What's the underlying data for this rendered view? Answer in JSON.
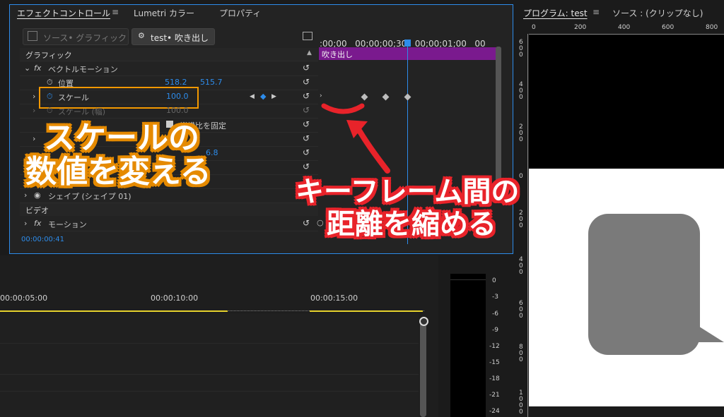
{
  "effect_panel": {
    "tabs": [
      "エフェクトコントロール",
      "Lumetri カラー",
      "プロパティ"
    ],
    "menu_icon": "≡",
    "source_label": "ソース• グラフィック",
    "clip_label": "test• 吹き出し",
    "timeline_ruler": ":00;00   00;00;00;30   00;00;01;00   00",
    "clip_bar_label": "吹き出し",
    "timecode": "00:00:00:41",
    "sections": {
      "graphic": "グラフィック",
      "vector_motion": "ベクトルモーション",
      "position": "位置",
      "position_x": "518.2",
      "position_y": "515.7",
      "scale": "スケール",
      "scale_value": "100.0",
      "scale_width": "スケール (幅)",
      "scale_width_value": "100.0",
      "uniform_scale": "縦横比を固定",
      "anchor_value": "6.8",
      "shape": "シェイプ (シェイプ 01)",
      "video": "ビデオ",
      "motion": "モーション"
    }
  },
  "program_monitor": {
    "title": "プログラム: test",
    "menu_icon": "≡",
    "source_tab": "ソース : (クリップなし)",
    "ruler_ticks": [
      "0",
      "200",
      "400",
      "600",
      "800"
    ],
    "v_ruler_ticks": [
      "6 0 0",
      "4 0 0",
      "2 0 0",
      "0",
      "2 0 0",
      "4 0 0",
      "6 0 0",
      "8 0 0",
      "1 0 0 0"
    ]
  },
  "timeline": {
    "times": [
      "00:00:05:00",
      "00:00:10:00",
      "00:00:15:00"
    ]
  },
  "audio_meter": {
    "levels": [
      "0",
      "-3",
      "-6",
      "-9",
      "-12",
      "-15",
      "-18",
      "-21",
      "-24"
    ]
  },
  "annotations": {
    "orange_line1": "スケールの",
    "orange_line2": "数値を変える",
    "red_line1": "キーフレーム間の",
    "red_line2": "距離を縮める",
    "orange_color": "#e58a00",
    "red_color": "#e8232a"
  }
}
